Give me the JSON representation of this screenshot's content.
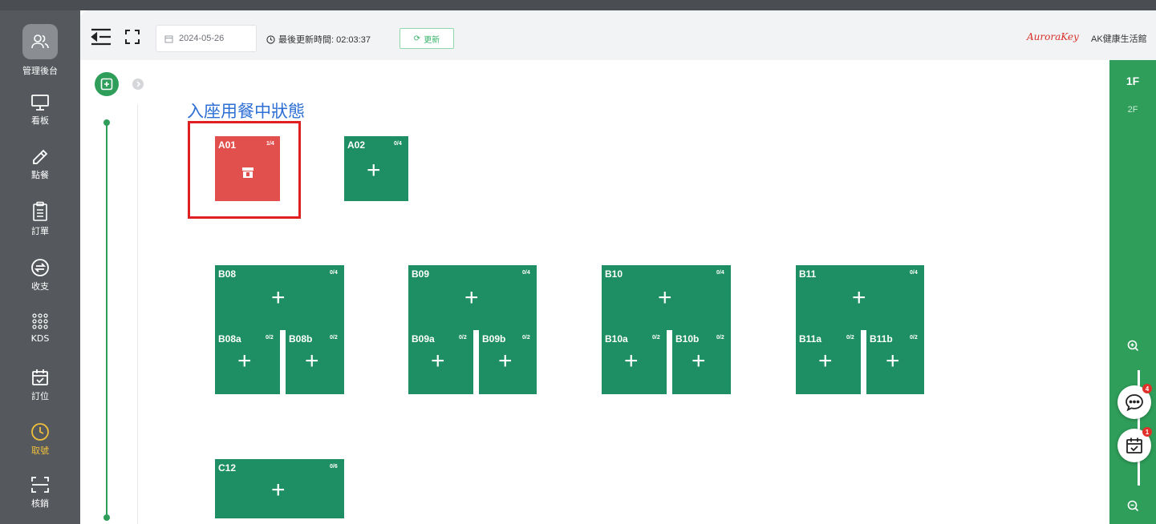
{
  "sidebar": {
    "header_label": "管理後台",
    "items": [
      {
        "icon": "monitor-icon",
        "label": "看板",
        "active": false
      },
      {
        "icon": "pencil-icon",
        "label": "點餐",
        "active": false
      },
      {
        "icon": "clipboard-icon",
        "label": "訂單",
        "active": false
      },
      {
        "icon": "exchange-icon",
        "label": "收支",
        "active": false
      },
      {
        "icon": "grid-dots-icon",
        "label": "KDS",
        "active": false
      },
      {
        "icon": "calendar-check-icon",
        "label": "訂位",
        "active": false
      },
      {
        "icon": "clock-icon",
        "label": "取號",
        "active": true
      },
      {
        "icon": "scan-icon",
        "label": "核銷",
        "active": false
      }
    ]
  },
  "topbar": {
    "date": "2024-05-26",
    "last_update_label": "最後更新時間: 02:03:37",
    "refresh_label": "更新",
    "brand_logo": "AuroraKey",
    "brand_name": "AK健康生活館"
  },
  "floor_plan": {
    "status_caption": "入座用餐中狀態",
    "tables": {
      "A01": {
        "name": "A01",
        "capacity": "1/4",
        "status": "occupied"
      },
      "A02": {
        "name": "A02",
        "capacity": "0/4",
        "status": "available"
      },
      "B08": {
        "name": "B08",
        "capacity": "0/4"
      },
      "B08a": {
        "name": "B08a",
        "capacity": "0/2"
      },
      "B08b": {
        "name": "B08b",
        "capacity": "0/2"
      },
      "B09": {
        "name": "B09",
        "capacity": "0/4"
      },
      "B09a": {
        "name": "B09a",
        "capacity": "0/2"
      },
      "B09b": {
        "name": "B09b",
        "capacity": "0/2"
      },
      "B10": {
        "name": "B10",
        "capacity": "0/4"
      },
      "B10a": {
        "name": "B10a",
        "capacity": "0/2"
      },
      "B10b": {
        "name": "B10b",
        "capacity": "0/2"
      },
      "B11": {
        "name": "B11",
        "capacity": "0/4"
      },
      "B11a": {
        "name": "B11a",
        "capacity": "0/2"
      },
      "B11b": {
        "name": "B11b",
        "capacity": "0/2"
      },
      "C12": {
        "name": "C12",
        "capacity": "0/6"
      }
    }
  },
  "floors": {
    "current": "1F",
    "other": "2F"
  },
  "fabs": {
    "chat_badge": "4",
    "calendar_badge": "1"
  },
  "colors": {
    "sidebar_bg": "#55585d",
    "table_available": "#1e8f64",
    "table_occupied": "#e2504d",
    "accent_green": "#2f9e5a",
    "active_menu": "#f0c03c",
    "caption_blue": "#2d6fd4",
    "highlight_red": "#e02020"
  }
}
